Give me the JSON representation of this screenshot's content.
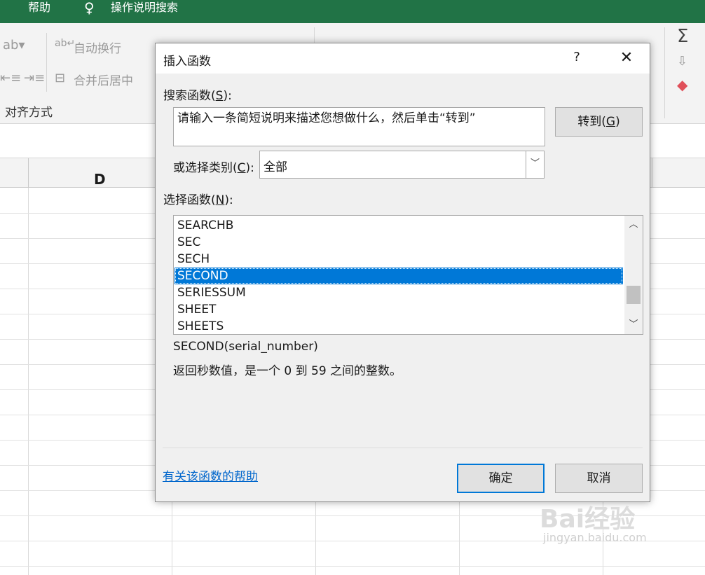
{
  "excel": {
    "tabs": [
      "帮助",
      "操作说明搜索"
    ],
    "ribbon": {
      "wrap_text": "自动换行",
      "merge_center": "合并后居中",
      "alignment_group": "对齐方式"
    },
    "column_d": "D"
  },
  "dialog": {
    "title": "插入函数",
    "help": "?",
    "search_label": "搜索函数(",
    "search_key": "S",
    "search_label_end": "):",
    "search_text": "请输入一条简短说明来描述您想做什么，然后单击“转到”",
    "goto_label": "转到(",
    "goto_key": "G",
    "goto_end": ")",
    "category_label": "或选择类别(",
    "category_key": "C",
    "category_end": "):",
    "category_value": "全部",
    "function_label": "选择函数(",
    "function_key": "N",
    "function_end": "):",
    "functions": [
      "SEARCHB",
      "SEC",
      "SECH",
      "SECOND",
      "SERIESSUM",
      "SHEET",
      "SHEETS"
    ],
    "selected_index": 3,
    "syntax": "SECOND(serial_number)",
    "description": "返回秒数值，是一个 0 到 59 之间的整数。",
    "help_link": "有关该函数的帮助",
    "ok": "确定",
    "cancel": "取消"
  },
  "watermark": {
    "brand": "Bai经验",
    "url": "jingyan.baidu.com"
  }
}
